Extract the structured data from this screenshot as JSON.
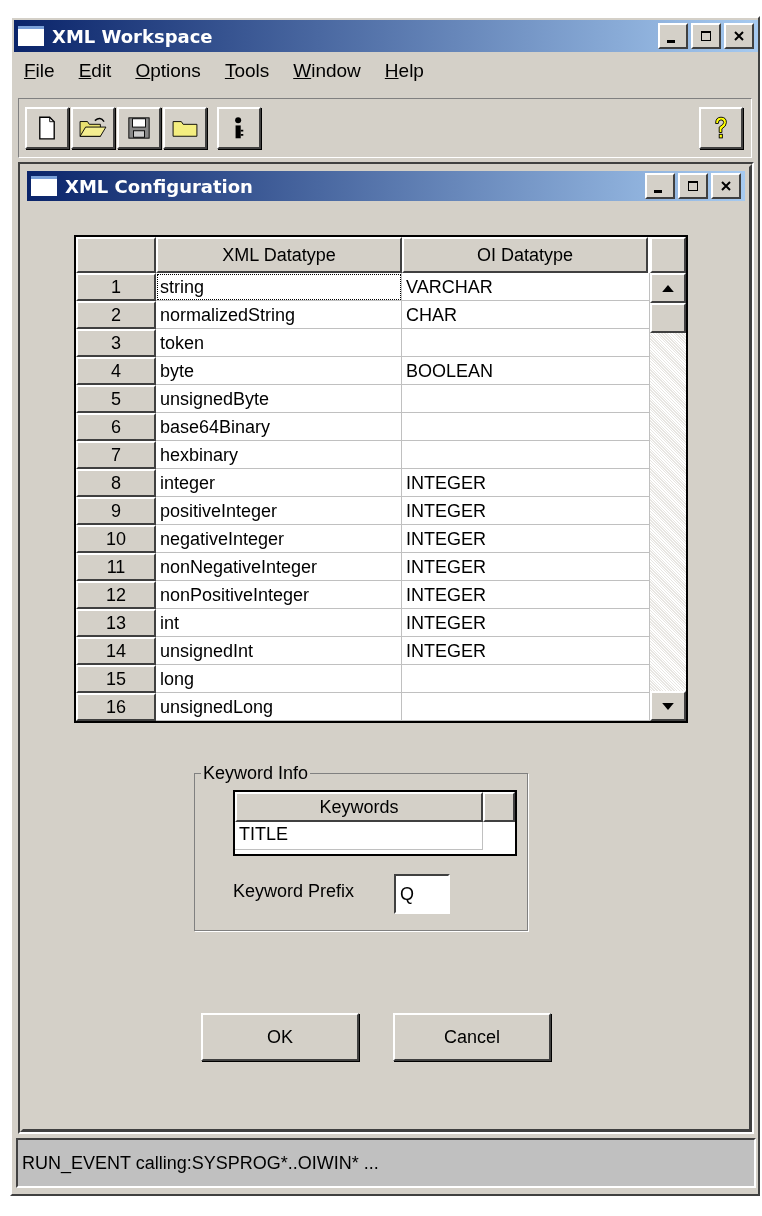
{
  "window": {
    "title": "XML Workspace"
  },
  "menu": [
    "File",
    "Edit",
    "Options",
    "Tools",
    "Window",
    "Help"
  ],
  "child_window": {
    "title": "XML Configuration"
  },
  "grid": {
    "columns": [
      "XML Datatype",
      "OI Datatype"
    ],
    "rows": [
      {
        "number": "1",
        "xml": "string",
        "oi": "VARCHAR",
        "focused": true
      },
      {
        "number": "2",
        "xml": "normalizedString",
        "oi": "CHAR",
        "focused": false
      },
      {
        "number": "3",
        "xml": "token",
        "focused": false
      },
      {
        "number": "4",
        "xml": "byte",
        "oi": "BOOLEAN",
        "focused": false
      },
      {
        "number": "5",
        "xml": "unsignedByte",
        "focused": false
      },
      {
        "number": "6",
        "xml": "base64Binary",
        "focused": false
      },
      {
        "number": "7",
        "xml": "hexbinary",
        "focused": false
      },
      {
        "number": "8",
        "xml": "integer",
        "oi": "INTEGER",
        "focused": false
      },
      {
        "number": "9",
        "xml": "positiveInteger",
        "oi": "INTEGER",
        "focused": false
      },
      {
        "number": "10",
        "xml": "negativeInteger",
        "oi": "INTEGER",
        "focused": false
      },
      {
        "number": "11",
        "xml": "nonNegativeInteger",
        "oi": "INTEGER",
        "focused": false
      },
      {
        "number": "12",
        "xml": "nonPositiveInteger",
        "oi": "INTEGER",
        "focused": false
      },
      {
        "number": "13",
        "xml": "int",
        "oi": "INTEGER",
        "focused": false
      },
      {
        "number": "14",
        "xml": "unsignedInt",
        "oi": "INTEGER",
        "focused": false
      },
      {
        "number": "15",
        "xml": "long",
        "focused": false
      },
      {
        "number": "16",
        "xml": "unsignedLong",
        "focused": false
      }
    ]
  },
  "keyword_info": {
    "title": "Keyword Info",
    "column": "Keywords",
    "rows": [
      "TITLE"
    ],
    "prefix_label": "Keyword Prefix",
    "prefix_value": "Q"
  },
  "buttons": [
    "OK",
    "Cancel"
  ],
  "status_bar": "RUN_EVENT calling:SYSPROG*..OIWIN* ..."
}
